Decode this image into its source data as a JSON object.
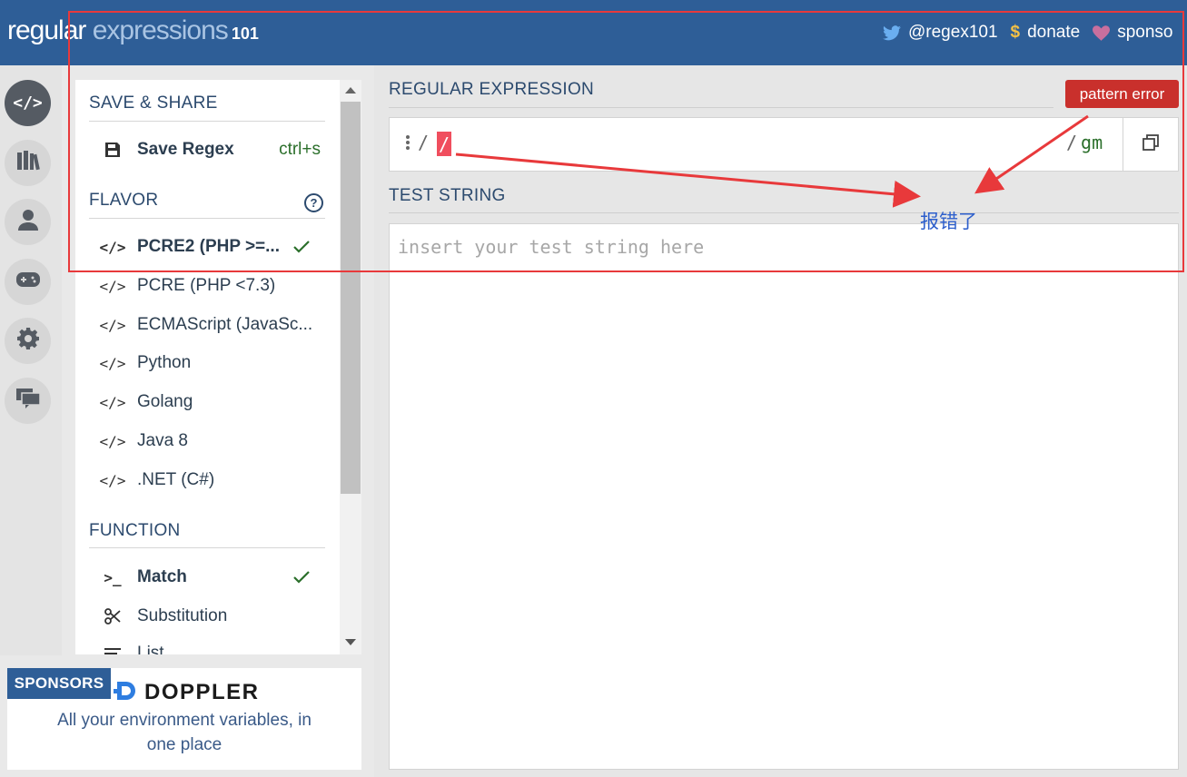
{
  "header": {
    "logo_part1": "regular",
    "logo_part2": " expressions",
    "logo_part3": "101",
    "links": [
      {
        "label": "@regex101",
        "icon": "twitter-icon"
      },
      {
        "label": "donate",
        "icon": "dollar-icon"
      },
      {
        "label": "sponso",
        "icon": "heart-icon"
      }
    ]
  },
  "rail": {
    "items": [
      {
        "icon": "code-icon",
        "active": true
      },
      {
        "icon": "library-icon"
      },
      {
        "icon": "user-icon"
      },
      {
        "icon": "gamepad-icon"
      },
      {
        "icon": "gear-icon"
      },
      {
        "icon": "chat-icon"
      }
    ]
  },
  "sidebar": {
    "save_share": {
      "title": "SAVE & SHARE",
      "save_label": "Save Regex",
      "save_shortcut": "ctrl+s"
    },
    "flavor": {
      "title": "FLAVOR",
      "help_icon": "help-icon",
      "items": [
        {
          "label": "PCRE2 (PHP >=...",
          "selected": true
        },
        {
          "label": "PCRE (PHP <7.3)"
        },
        {
          "label": "ECMAScript (JavaSc..."
        },
        {
          "label": "Python"
        },
        {
          "label": "Golang"
        },
        {
          "label": "Java 8"
        },
        {
          "label": ".NET (C#)"
        }
      ]
    },
    "function": {
      "title": "FUNCTION",
      "items": [
        {
          "label": "Match",
          "selected": true,
          "icon": "terminal-icon"
        },
        {
          "label": "Substitution",
          "icon": "scissors-icon"
        },
        {
          "label": "List",
          "icon": "list-icon"
        }
      ]
    }
  },
  "sponsors": {
    "tag": "SPONSORS",
    "brand": "DOPPLER",
    "line1": "All your environment variables, in",
    "line2": "one place"
  },
  "main": {
    "regex_label": "REGULAR EXPRESSION",
    "error_badge": "pattern error",
    "regex_open": "/",
    "regex_value": "/",
    "regex_close": "/",
    "regex_flags": "gm",
    "test_label": "TEST STRING",
    "test_placeholder": "insert your test string here"
  },
  "annotation": {
    "text": "报错了",
    "color": "#e8393b",
    "text_color": "#2d5fcc"
  },
  "colors": {
    "header_bg": "#2e5e97",
    "error": "#c9302c",
    "regex_highlight": "#f04e5e",
    "flag_green": "#2b6f2b"
  }
}
